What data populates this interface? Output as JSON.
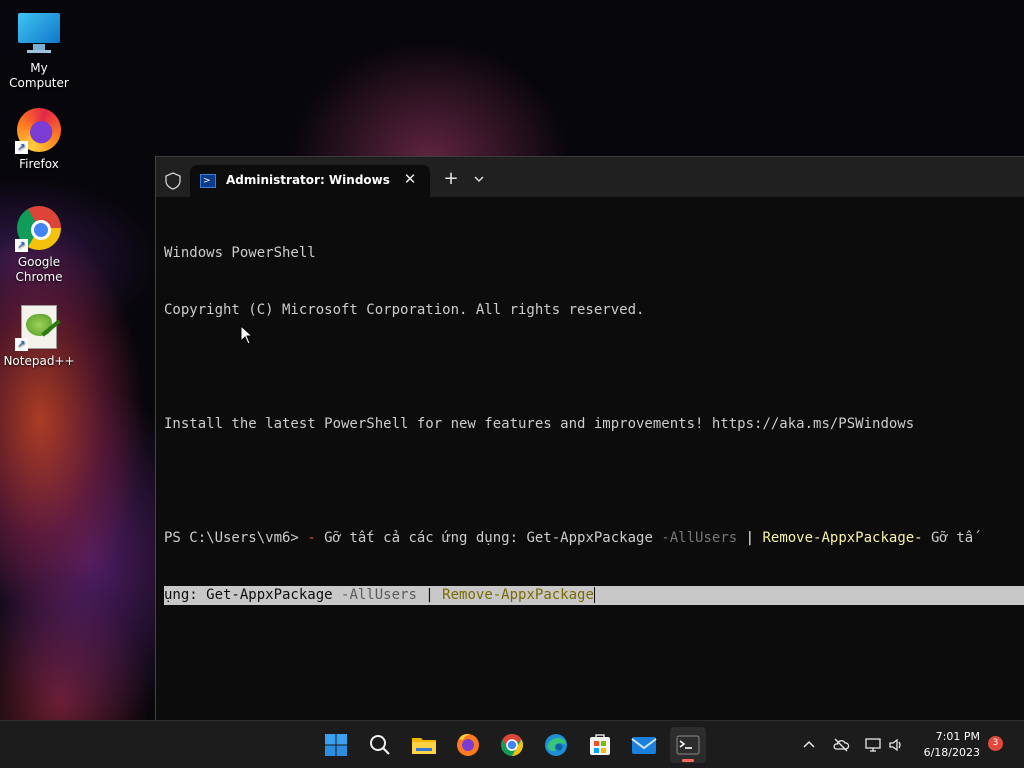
{
  "desktop": {
    "icons": [
      {
        "label": "My Computer",
        "icon": "computer-icon"
      },
      {
        "label": "Firefox",
        "icon": "firefox-icon"
      },
      {
        "label": "Google Chrome",
        "icon": "chrome-icon"
      },
      {
        "label": "Notepad++",
        "icon": "notepadpp-icon"
      }
    ],
    "shortcut_glyph": "↗"
  },
  "terminal": {
    "tab": {
      "title": "Administrator: Windows PowerShell",
      "close_glyph": "✕"
    },
    "new_tab_glyph": "+",
    "lines": {
      "l1": "Windows PowerShell",
      "l2": "Copyright (C) Microsoft Corporation. All rights reserved.",
      "l3": "Install the latest PowerShell for new features and improvements! https://aka.ms/PSWindows",
      "prompt": "PS C:\\Users\\vm6> ",
      "cmd1_dash": "-",
      "cmd1_text": " Gỡ tất cả các ứng dụng: Get-AppxPackage ",
      "cmd1_param": "-AllUsers",
      "cmd1_pipe": " | ",
      "cmd1_cmdlet": "Remove-AppxPackage-",
      "cmd1_tail": " Gỡ tấ",
      "cmd2_text": "ụng: Get-AppxPackage ",
      "cmd2_param": "-AllUsers",
      "cmd2_pipe": " | ",
      "cmd2_cmdlet": "Remove-AppxPackage"
    }
  },
  "taskbar": {
    "apps": [
      {
        "name": "start",
        "icon": "windows-logo-icon"
      },
      {
        "name": "search",
        "icon": "search-icon"
      },
      {
        "name": "file-explorer",
        "icon": "folder-icon"
      },
      {
        "name": "firefox",
        "icon": "firefox-icon"
      },
      {
        "name": "chrome",
        "icon": "chrome-icon"
      },
      {
        "name": "edge",
        "icon": "edge-icon"
      },
      {
        "name": "microsoft-store",
        "icon": "store-icon"
      },
      {
        "name": "mail",
        "icon": "mail-icon"
      },
      {
        "name": "terminal",
        "icon": "terminal-icon",
        "active": true
      }
    ],
    "tray": {
      "chevron_glyph": "^",
      "time": "7:01 PM",
      "date": "6/18/2023",
      "notification_count": "3"
    }
  },
  "colors": {
    "terminal_bg": "#0c0c0c",
    "titlebar_bg": "#202020",
    "cmdlet": "#f9f1a5",
    "parameter": "#767676",
    "prompt_dash": "#e74856",
    "selection": "#c8c8c8",
    "taskbar_bg": "#1c1c1c",
    "badge": "#e14a3b"
  }
}
